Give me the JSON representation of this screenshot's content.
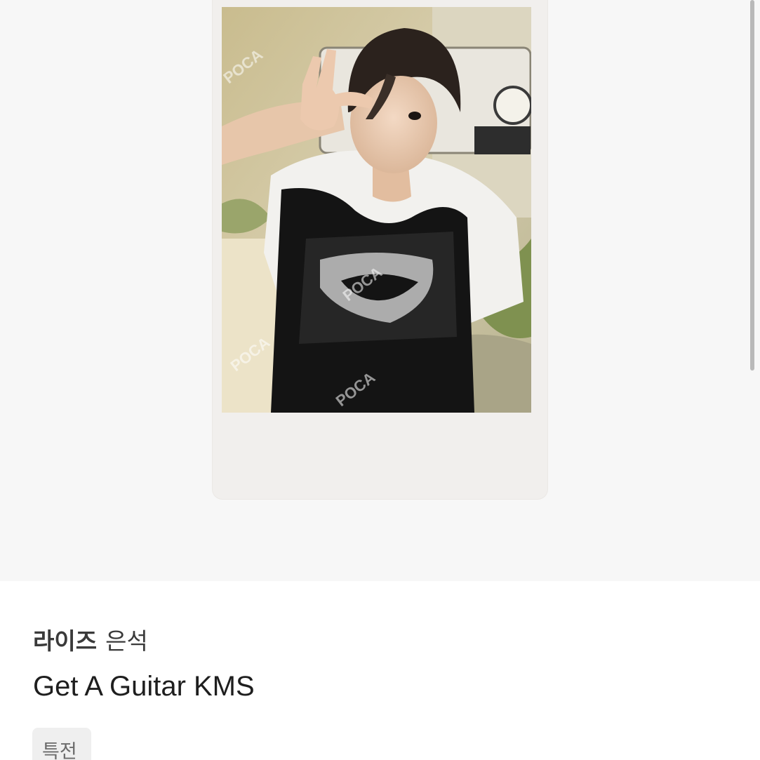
{
  "listing": {
    "artist_group": "라이즈",
    "artist_member": "은석",
    "title": "Get A Guitar KMS",
    "tag": "특전"
  },
  "photo": {
    "watermark": "POCA"
  }
}
